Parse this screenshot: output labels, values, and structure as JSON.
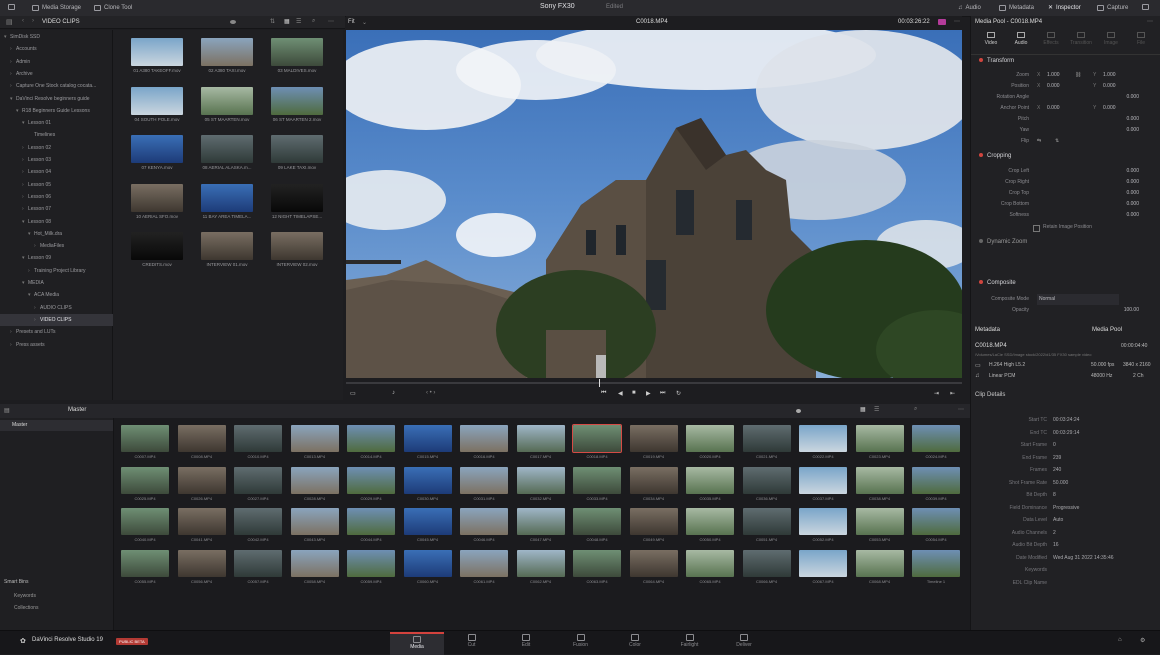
{
  "topbar": {
    "media_storage": "Media Storage",
    "clone_tool": "Clone Tool",
    "project_title": "Sony FX30",
    "edited": "Edited",
    "audio": "Audio",
    "metadata": "Metadata",
    "inspector": "Inspector",
    "capture": "Capture"
  },
  "browser": {
    "header": "VIDEO CLIPS",
    "tree": [
      {
        "label": "SimDisk SSD",
        "indent": 0,
        "arrow": "▾"
      },
      {
        "label": "Accounts",
        "indent": 1,
        "arrow": "›"
      },
      {
        "label": "Admin",
        "indent": 1,
        "arrow": "›"
      },
      {
        "label": "Archive",
        "indent": 1,
        "arrow": "›"
      },
      {
        "label": "Capture One Stock catalog cocata...",
        "indent": 1,
        "arrow": "›"
      },
      {
        "label": "DaVinci Resolve beginners guide",
        "indent": 1,
        "arrow": "▾"
      },
      {
        "label": "R18 Beginners Guide Lessons",
        "indent": 2,
        "arrow": "▾"
      },
      {
        "label": "Lesson 01",
        "indent": 3,
        "arrow": "▾"
      },
      {
        "label": "Timelines",
        "indent": 4,
        "arrow": ""
      },
      {
        "label": "Lesson 02",
        "indent": 3,
        "arrow": "›"
      },
      {
        "label": "Lesson 03",
        "indent": 3,
        "arrow": "›"
      },
      {
        "label": "Lesson 04",
        "indent": 3,
        "arrow": "›"
      },
      {
        "label": "Lesson 05",
        "indent": 3,
        "arrow": "›"
      },
      {
        "label": "Lesson 06",
        "indent": 3,
        "arrow": "›"
      },
      {
        "label": "Lesson 07",
        "indent": 3,
        "arrow": "›"
      },
      {
        "label": "Lesson 08",
        "indent": 3,
        "arrow": "▾"
      },
      {
        "label": "Hot_Milk.dra",
        "indent": 4,
        "arrow": "▾"
      },
      {
        "label": "MediaFiles",
        "indent": 5,
        "arrow": "›"
      },
      {
        "label": "Lesson 09",
        "indent": 3,
        "arrow": "▾"
      },
      {
        "label": "Training Project Library",
        "indent": 4,
        "arrow": "›"
      },
      {
        "label": "MEDIA",
        "indent": 3,
        "arrow": "▾"
      },
      {
        "label": "ACA Media",
        "indent": 4,
        "arrow": "▾"
      },
      {
        "label": "AUDIO CLIPS",
        "indent": 5,
        "arrow": "›"
      },
      {
        "label": "VIDEO CLIPS",
        "indent": 5,
        "arrow": "›",
        "selected": true
      },
      {
        "label": "Presets and LUTs",
        "indent": 1,
        "arrow": "›"
      },
      {
        "label": "Press assets",
        "indent": 1,
        "arrow": "›"
      }
    ],
    "thumbs": [
      {
        "label": "01 A380 TAKEOFF.mov",
        "style": "g2"
      },
      {
        "label": "02 A380 TAXI.mov",
        "style": "g9"
      },
      {
        "label": "03 MALDIVES.mov",
        "style": "g3"
      },
      {
        "label": "04 SOUTH POLE.mov",
        "style": "g2"
      },
      {
        "label": "05 ST MAARTEN.mov",
        "style": "g8"
      },
      {
        "label": "06 ST MAARTEN 2.mov",
        "style": "g10"
      },
      {
        "label": "07 KENYA.mov",
        "style": "g5"
      },
      {
        "label": "08 AERIAL ALASKA.m...",
        "style": "g4"
      },
      {
        "label": "09 LAKE TAXI.mov",
        "style": "g4"
      },
      {
        "label": "10 AERIAL SFO.mov",
        "style": "g7"
      },
      {
        "label": "11 BAY AREA TIMELA...",
        "style": "g5"
      },
      {
        "label": "12 NIGHT TIMELAPSE...",
        "style": "g6"
      },
      {
        "label": "CREDITS.mov",
        "style": "g6"
      },
      {
        "label": "INTERVIEW 01.mov",
        "style": "g7"
      },
      {
        "label": "INTERVIEW 02.mov",
        "style": "g7"
      }
    ]
  },
  "viewer": {
    "fit": "Fit",
    "clip_name": "C0018.MP4",
    "timecode": "00:03:26:22"
  },
  "inspector": {
    "header": "Media Pool - C0018.MP4",
    "tabs": [
      "Video",
      "Audio",
      "Effects",
      "Transition",
      "Image",
      "File"
    ],
    "transform": {
      "title": "Transform",
      "zoom_label": "Zoom",
      "zoom_x": "1.000",
      "zoom_y": "1.000",
      "position_label": "Position",
      "position_x": "0.000",
      "position_y": "0.000",
      "rotation_label": "Rotation Angle",
      "rotation": "0.000",
      "anchor_label": "Anchor Point",
      "anchor_x": "0.000",
      "anchor_y": "0.000",
      "pitch_label": "Pitch",
      "pitch": "0.000",
      "yaw_label": "Yaw",
      "yaw": "0.000",
      "flip_label": "Flip"
    },
    "cropping": {
      "title": "Cropping",
      "left_label": "Crop Left",
      "left": "0.000",
      "right_label": "Crop Right",
      "right": "0.000",
      "top_label": "Crop Top",
      "top": "0.000",
      "bottom_label": "Crop Bottom",
      "bottom": "0.000",
      "softness_label": "Softness",
      "softness": "0.000",
      "retain_label": "Retain Image Position"
    },
    "dynamic_zoom": {
      "title": "Dynamic Zoom"
    },
    "composite": {
      "title": "Composite",
      "mode_label": "Composite Mode",
      "mode": "Normal",
      "opacity_label": "Opacity",
      "opacity": "100.00"
    }
  },
  "metadata": {
    "header": "Metadata",
    "media_pool": "Media Pool",
    "clip": "C0018.MP4",
    "duration": "00:00:04:40",
    "path": "/Volumes/LaCie SSD/Image stock/2022/d1/35 FX30 sample video",
    "codec": "H.264 High L5.2",
    "fps": "50.000 fps",
    "resolution": "3840 x 2160",
    "audio": "Linear PCM",
    "hz": "48000 Hz",
    "channels": "2 Ch",
    "clip_details": "Clip Details",
    "details": [
      {
        "k": "Start TC",
        "v": "00:03:24:24"
      },
      {
        "k": "End TC",
        "v": "00:03:29:14"
      },
      {
        "k": "Start Frame",
        "v": "0"
      },
      {
        "k": "End Frame",
        "v": "239"
      },
      {
        "k": "Frames",
        "v": "240"
      },
      {
        "k": "Shot Frame Rate",
        "v": "50.000"
      },
      {
        "k": "Bit Depth",
        "v": "8"
      },
      {
        "k": "Field Dominance",
        "v": "Progressive"
      },
      {
        "k": "Data Level",
        "v": "Auto"
      },
      {
        "k": "Audio Channels",
        "v": "2"
      },
      {
        "k": "Audio Bit Depth",
        "v": "16"
      },
      {
        "k": "Date Modified",
        "v": "Wed Aug 31 2022 14:35:46"
      },
      {
        "k": "Keywords",
        "v": ""
      },
      {
        "k": "EDL Clip Name",
        "v": ""
      }
    ]
  },
  "mediapool": {
    "header": "Master",
    "bin": "Master",
    "smart_bins": "Smart Bins",
    "keywords": "Keywords",
    "collections": "Collections",
    "clips": [
      "C0007.MP4",
      "C0008.MP4",
      "C0010.MP4",
      "C0013.MP4",
      "C0014.MP4",
      "C0015.MP4",
      "C0016.MP4",
      "C0017.MP4",
      "C0018.MP4",
      "C0019.MP4",
      "C0020.MP4",
      "C0021.MP4",
      "C0022.MP4",
      "C0023.MP4",
      "C0024.MP4",
      "C0025.MP4",
      "C0026.MP4",
      "C0027.MP4",
      "C0028.MP4",
      "C0029.MP4",
      "C0030.MP4",
      "C0031.MP4",
      "C0032.MP4",
      "C0033.MP4",
      "C0034.MP4",
      "C0035.MP4",
      "C0036.MP4",
      "C0037.MP4",
      "C0038.MP4",
      "C0039.MP4",
      "C0040.MP4",
      "C0041.MP4",
      "C0042.MP4",
      "C0043.MP4",
      "C0044.MP4",
      "C0045.MP4",
      "C0046.MP4",
      "C0047.MP4",
      "C0048.MP4",
      "C0049.MP4",
      "C0050.MP4",
      "C0051.MP4",
      "C0052.MP4",
      "C0053.MP4",
      "C0054.MP4",
      "C0055.MP4",
      "C0056.MP4",
      "C0057.MP4",
      "C0058.MP4",
      "C0059.MP4",
      "C0060.MP4",
      "C0061.MP4",
      "C0062.MP4",
      "C0063.MP4",
      "C0064.MP4",
      "C0065.MP4",
      "C0066.MP4",
      "C0067.MP4",
      "C0068.MP4",
      "Timeline 1"
    ],
    "selected": "C0018.MP4"
  },
  "bottombar": {
    "app_name": "DaVinci Resolve Studio 19",
    "badge": "PUBLIC BETA",
    "pages": [
      "Media",
      "Cut",
      "Edit",
      "Fusion",
      "Color",
      "Fairlight",
      "Deliver"
    ],
    "active_page": "Media"
  }
}
